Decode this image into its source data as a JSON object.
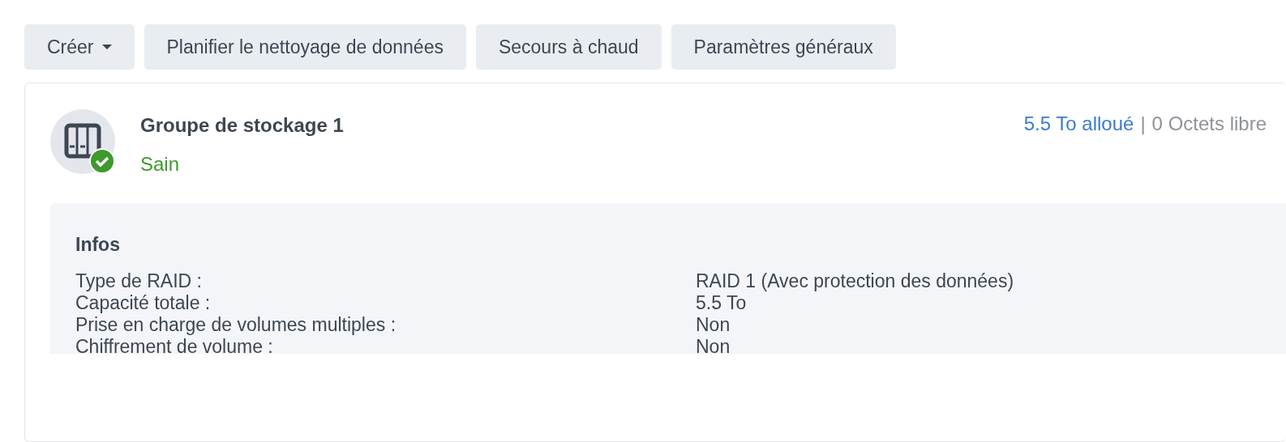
{
  "toolbar": [
    {
      "label": "Créer",
      "kind": "dropdown"
    },
    {
      "label": "Planifier le nettoyage de données",
      "kind": "button"
    },
    {
      "label": "Secours à chaud",
      "kind": "button"
    },
    {
      "label": "Paramètres généraux",
      "kind": "button"
    }
  ],
  "pool": {
    "title": "Groupe de stockage 1",
    "status": "Sain",
    "healthy": true,
    "allocated": "5.5 To alloué",
    "separator": "|",
    "free": "0 Octets libre",
    "info": {
      "heading": "Infos",
      "rows": [
        {
          "label": "Type de RAID :",
          "value": "RAID 1 (Avec protection des données)"
        },
        {
          "label": "Capacité totale :",
          "value": "5.5 To"
        },
        {
          "label": "Prise en charge de volumes multiples :",
          "value": "Non"
        },
        {
          "label": "Chiffrement de volume :",
          "value": "Non"
        }
      ]
    }
  }
}
